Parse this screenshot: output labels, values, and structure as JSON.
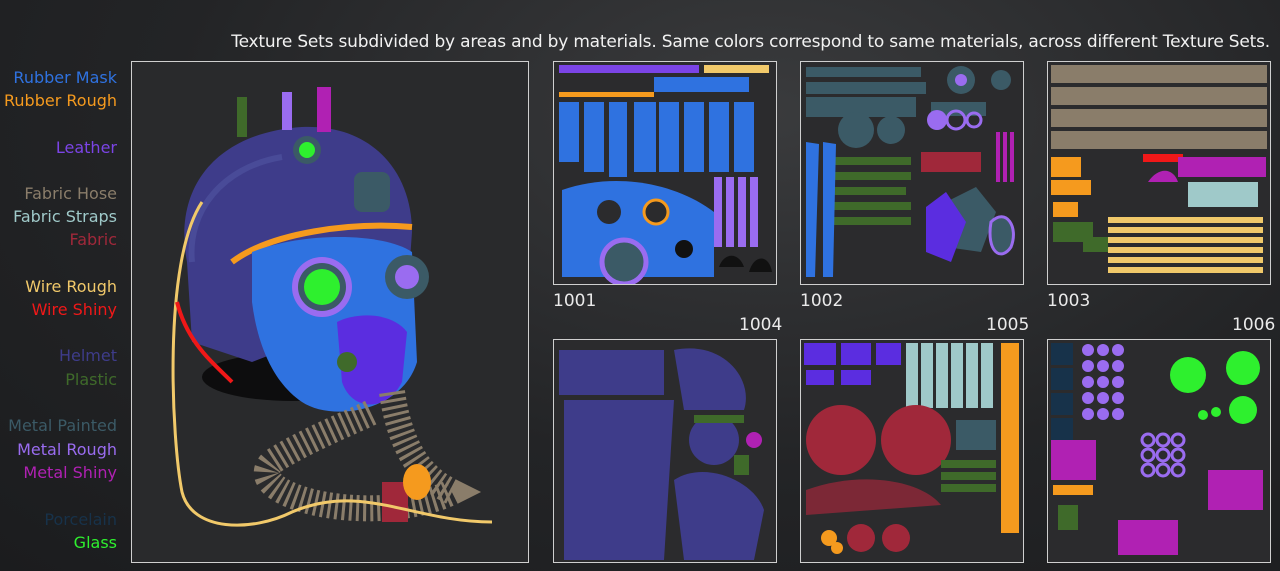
{
  "caption": "Texture Sets subdivided by areas and by materials. Same colors correspond to same materials, across different Texture Sets.",
  "legend": [
    {
      "label": "Rubber Mask",
      "color": "#2f72e0"
    },
    {
      "label": "Rubber Rough",
      "color": "#f59a1e"
    },
    {
      "label": "Leather",
      "color": "#7b44e6"
    },
    {
      "label": "Fabric Hose",
      "color": "#8a7d6a"
    },
    {
      "label": "Fabric Straps",
      "color": "#9fc9c9"
    },
    {
      "label": "Fabric",
      "color": "#a0283a"
    },
    {
      "label": "Wire Rough",
      "color": "#f1c96a"
    },
    {
      "label": "Wire Shiny",
      "color": "#f01818"
    },
    {
      "label": "Helmet",
      "color": "#3e3c8a"
    },
    {
      "label": "Plastic",
      "color": "#3f6a2a"
    },
    {
      "label": "Metal Painted",
      "color": "#3b5a66"
    },
    {
      "label": "Metal Rough",
      "color": "#9a6cf0"
    },
    {
      "label": "Metal Shiny",
      "color": "#b021b3"
    },
    {
      "label": "Porcelain",
      "color": "#17324a"
    },
    {
      "label": "Glass",
      "color": "#2ef02e"
    }
  ],
  "texture_sets": [
    {
      "id": "1001",
      "icon": "uv-map-rubber-mask"
    },
    {
      "id": "1002",
      "icon": "uv-map-metal-painted"
    },
    {
      "id": "1003",
      "icon": "uv-map-fabric-hose"
    },
    {
      "id": "1004",
      "icon": "uv-map-helmet"
    },
    {
      "id": "1005",
      "icon": "uv-map-fabric"
    },
    {
      "id": "1006",
      "icon": "uv-map-glass-metal"
    }
  ],
  "viewport": {
    "icon": "helmet-3d-model"
  }
}
